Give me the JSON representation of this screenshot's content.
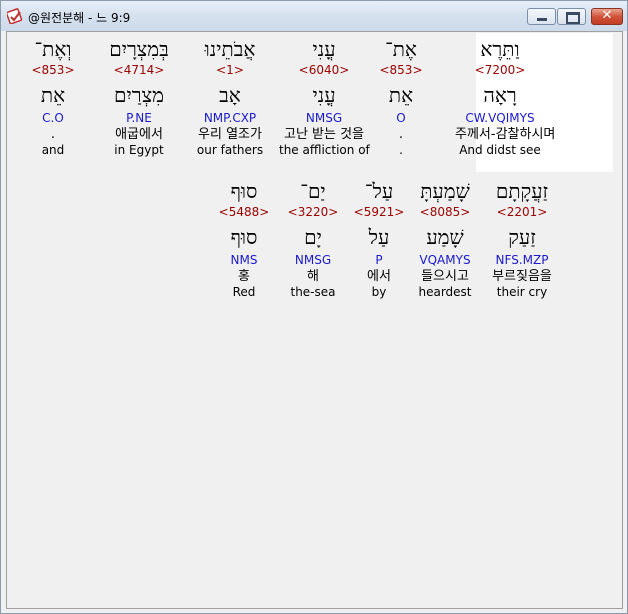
{
  "window": {
    "title": "@원전분해 - 느 9:9",
    "close_glyph": "✕"
  },
  "rows": [
    {
      "words": [
        {
          "hebrew": "וַתֵּרֶא",
          "strong": "<7200>",
          "lemma": "רָאָה",
          "morph": "CW.VQIMYS",
          "korean": "주께서-감찰하시며",
          "english": "And didst see",
          "highlighted": true
        },
        {
          "hebrew": "אֶת־",
          "strong": "<853>",
          "lemma": "אֵת",
          "morph": "O",
          "korean": ".",
          "english": "."
        },
        {
          "hebrew": "עֳנִי",
          "strong": "<6040>",
          "lemma": "עֳנִי",
          "morph": "NMSG",
          "korean": "고난 받는 것을",
          "english": "the affliction of"
        },
        {
          "hebrew": "אֲבֹתֵינוּ",
          "strong": "<1>",
          "lemma": "אָב",
          "morph": "NMP.CXP",
          "korean": "우리 열조가",
          "english": "our fathers"
        },
        {
          "hebrew": "בְּמִצְרָיִם",
          "strong": "<4714>",
          "lemma": "מִצְרַיִם",
          "morph": "P.NE",
          "korean": "애굽에서",
          "english": "in Egypt"
        },
        {
          "hebrew": "וְאֶת־",
          "strong": "<853>",
          "lemma": "אֵת",
          "morph": "C.O",
          "korean": ".",
          "english": "and"
        }
      ]
    },
    {
      "words": [
        {
          "hebrew": "זַעֲקָתָם",
          "strong": "<2201>",
          "lemma": "זַעַק",
          "morph": "NFS.MZP",
          "korean": "부르짖음을",
          "english": "their cry"
        },
        {
          "hebrew": "שָׁמַעְתָּ",
          "strong": "<8085>",
          "lemma": "שָׁמַע",
          "morph": "VQAMYS",
          "korean": "들으시고",
          "english": "heardest"
        },
        {
          "hebrew": "עַל־",
          "strong": "<5921>",
          "lemma": "עַל",
          "morph": "P",
          "korean": "에서",
          "english": "by"
        },
        {
          "hebrew": "יַם־",
          "strong": "<3220>",
          "lemma": "יָם",
          "morph": "NMSG",
          "korean": "해",
          "english": "the-sea"
        },
        {
          "hebrew": "סוּף",
          "strong": "<5488>",
          "lemma": "סוּף",
          "morph": "NMS",
          "korean": "홍",
          "english": "Red"
        }
      ]
    }
  ]
}
